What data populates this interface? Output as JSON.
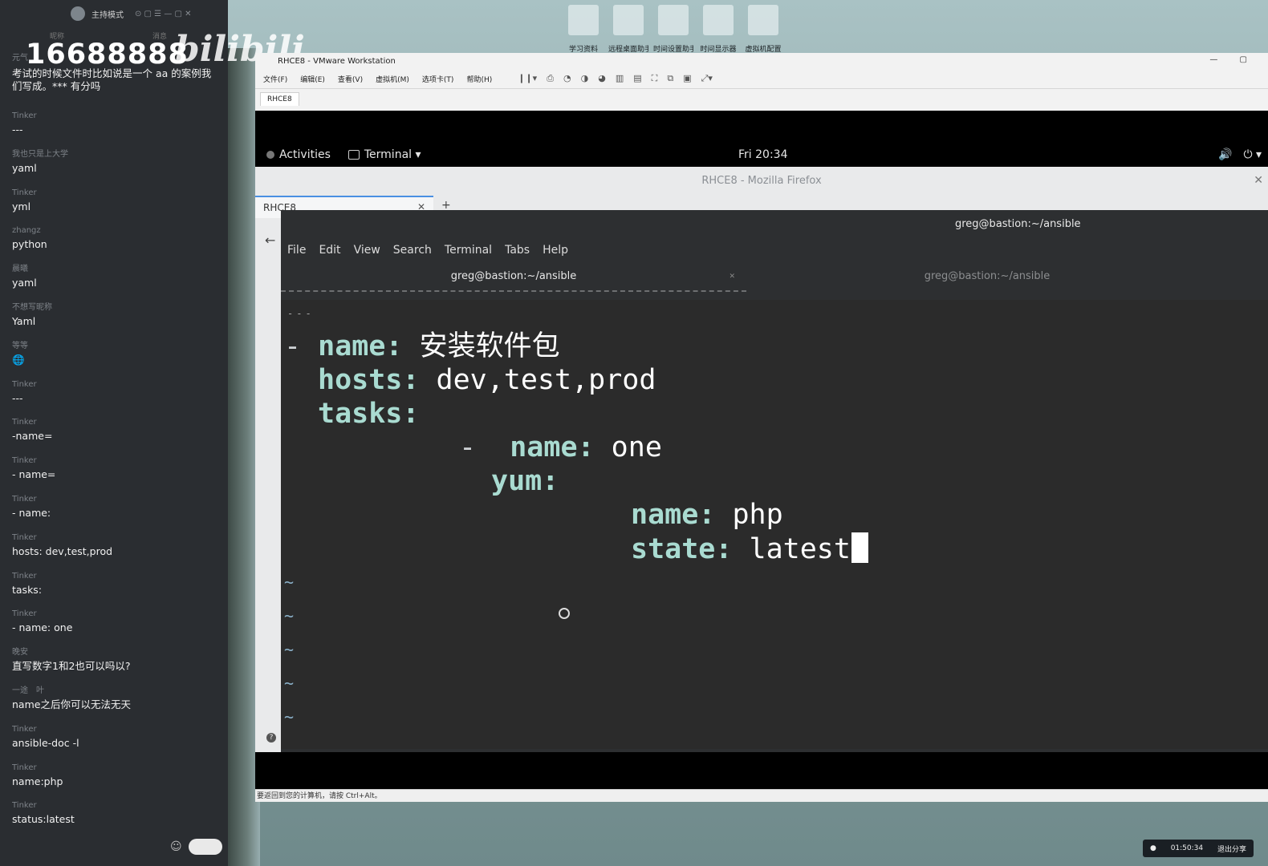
{
  "chat": {
    "host_label": "主持模式",
    "col_left": "昵称",
    "col_right": "消息",
    "counter": "16688888",
    "logo": "bilibili",
    "messages": [
      {
        "user": "元气",
        "text": "考试的时候文件时比如说是一个 aa 的案例我们写成。*** 有分吗"
      },
      {
        "user": "Tinker",
        "text": "---"
      },
      {
        "user": "我也只是上大学",
        "text": "yaml"
      },
      {
        "user": "Tinker",
        "text": "yml"
      },
      {
        "user": "zhangz",
        "text": "python"
      },
      {
        "user": "晨曦",
        "text": "yaml"
      },
      {
        "user": "不想写昵称",
        "text": "Yaml"
      },
      {
        "user": "等等",
        "text": "🌐"
      },
      {
        "user": "Tinker",
        "text": "---"
      },
      {
        "user": "Tinker",
        "text": "-name="
      },
      {
        "user": "Tinker",
        "text": "- name="
      },
      {
        "user": "Tinker",
        "text": "- name:"
      },
      {
        "user": "Tinker",
        "text": "hosts: dev,test,prod"
      },
      {
        "user": "Tinker",
        "text": "tasks:"
      },
      {
        "user": "Tinker",
        "text": "- name: one"
      },
      {
        "user": "晚安",
        "text": "直写数字1和2也可以吗以?"
      },
      {
        "user": "一途　叶",
        "text": "name之后你可以无法无天"
      },
      {
        "user": "Tinker",
        "text": "ansible-doc -l"
      },
      {
        "user": "Tinker",
        "text": "name:php"
      },
      {
        "user": "Tinker",
        "text": "status:latest"
      }
    ]
  },
  "desktop_icons": [
    "学习资料",
    "远程桌面助手",
    "时间设置助手",
    "时间显示器",
    "虚拟机配置"
  ],
  "vmware": {
    "title": "RHCE8 - VMware Workstation",
    "menu": [
      "文件(F)",
      "编辑(E)",
      "查看(V)",
      "虚拟机(M)",
      "选项卡(T)",
      "帮助(H)"
    ],
    "tab": "RHCE8",
    "status": "要返回到您的计算机，请按 Ctrl+Alt。"
  },
  "gnome": {
    "activities": "Activities",
    "app": "Terminal ▾",
    "clock": "Fri 20:34"
  },
  "firefox": {
    "title": "RHCE8 - Mozilla Firefox",
    "tab": "RHCE8"
  },
  "terminal": {
    "title": "greg@bastion:~/ansible",
    "menu": [
      "File",
      "Edit",
      "View",
      "Search",
      "Terminal",
      "Tabs",
      "Help"
    ],
    "tab_active": "greg@bastion:~/ansible",
    "tab_inactive": "greg@bastion:~/ansible",
    "code": {
      "l1_key": "name:",
      "l1_val": "安装软件包",
      "l2_key": "hosts:",
      "l2_val": "dev,test,prod",
      "l3_key": "tasks:",
      "l4_key": "name:",
      "l4_val": "one",
      "l5_key": "yum:",
      "l6_key": "name:",
      "l6_val": "php",
      "l7_key": "state:",
      "l7_val": "latest"
    }
  },
  "recording": {
    "time": "01:50:34",
    "exit": "退出分享"
  }
}
